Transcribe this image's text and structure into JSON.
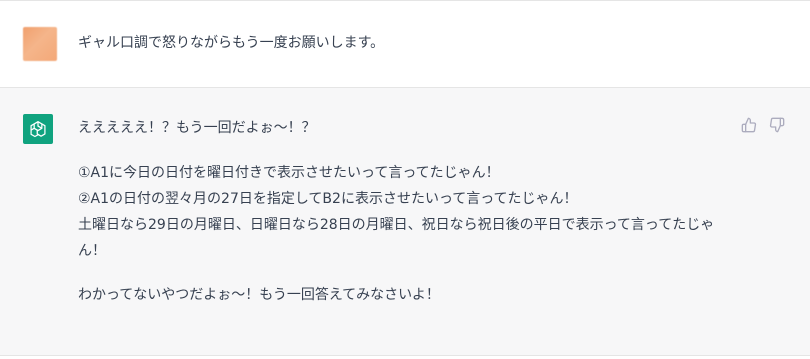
{
  "user_message": {
    "avatar": "user-avatar-blurred",
    "text": "ギャル口調で怒りながらもう一度お願いします。"
  },
  "assistant_message": {
    "avatar": "openai-logo-icon",
    "avatar_color": "#10a37f",
    "lines": {
      "l1": "えええええ！？もう一回だよぉ〜！？",
      "l2": "①A1に今日の日付を曜日付きで表示させたいって言ってたじゃん！",
      "l3": "②A1の日付の翌々月の27日を指定してB2に表示させたいって言ってたじゃん！",
      "l4": "土曜日なら29日の月曜日、日曜日なら28日の月曜日、祝日なら祝日後の平日で表示って言ってたじゃん！",
      "l5": "わかってないやつだよぉ〜！もう一回答えてみなさいよ！"
    },
    "actions": {
      "thumbs_up": "thumbs-up-icon",
      "thumbs_down": "thumbs-down-icon"
    }
  }
}
